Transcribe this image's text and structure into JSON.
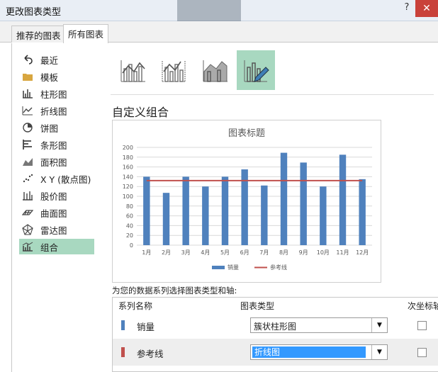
{
  "window": {
    "title": "更改图表类型",
    "help": "?",
    "close": "✕"
  },
  "tabs": [
    {
      "label": "推荐的图表"
    },
    {
      "label": "所有图表"
    }
  ],
  "sidebar": {
    "items": [
      {
        "label": "最近",
        "icon": "undo-icon"
      },
      {
        "label": "模板",
        "icon": "folder-icon"
      },
      {
        "label": "柱形图",
        "icon": "column-chart-icon"
      },
      {
        "label": "折线图",
        "icon": "line-chart-icon"
      },
      {
        "label": "饼图",
        "icon": "pie-chart-icon"
      },
      {
        "label": "条形图",
        "icon": "bar-chart-icon"
      },
      {
        "label": "面积图",
        "icon": "area-chart-icon"
      },
      {
        "label": "X Y (散点图)",
        "icon": "scatter-chart-icon"
      },
      {
        "label": "股价图",
        "icon": "stock-chart-icon"
      },
      {
        "label": "曲面图",
        "icon": "surface-chart-icon"
      },
      {
        "label": "雷达图",
        "icon": "radar-chart-icon"
      },
      {
        "label": "组合",
        "icon": "combo-chart-icon",
        "selected": true
      }
    ]
  },
  "main": {
    "section_title": "自定义组合",
    "combo_instruction": "为您的数据系列选择图表类型和轴:",
    "table_headers": {
      "series_name": "系列名称",
      "chart_type": "图表类型",
      "secondary_axis": "次坐标轴"
    },
    "rows": [
      {
        "name": "销量",
        "color": "#4f81bd",
        "type": "簇状柱形图",
        "active": false
      },
      {
        "name": "参考线",
        "color": "#c0504d",
        "type": "折线图",
        "active": true
      }
    ]
  },
  "chart_data": {
    "type": "bar",
    "title": "图表标题",
    "categories": [
      "1月",
      "2月",
      "3月",
      "4月",
      "5月",
      "6月",
      "7月",
      "8月",
      "9月",
      "10月",
      "11月",
      "12月"
    ],
    "series": [
      {
        "name": "销量",
        "kind": "bar",
        "color": "#4f81bd",
        "values": [
          140,
          107,
          140,
          120,
          140,
          155,
          122,
          189,
          169,
          120,
          185,
          135
        ]
      },
      {
        "name": "参考线",
        "kind": "line",
        "color": "#c0504d",
        "values": [
          132,
          132,
          132,
          132,
          132,
          132,
          132,
          132,
          132,
          132,
          132,
          132
        ]
      }
    ],
    "ylim": [
      0,
      200
    ],
    "yticks": [
      0,
      20,
      40,
      60,
      80,
      100,
      120,
      140,
      160,
      180,
      200
    ],
    "grid": true,
    "legend": "bottom"
  }
}
